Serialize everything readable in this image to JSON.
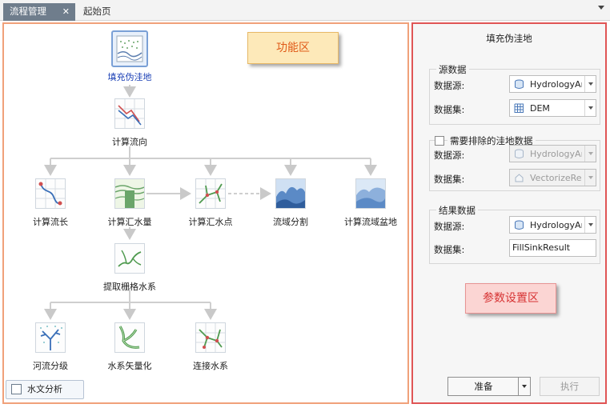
{
  "tabs": [
    {
      "label": "流程管理",
      "active": true,
      "close_icon": "close-icon"
    },
    {
      "label": "起始页",
      "active": false
    }
  ],
  "canvas": {
    "callout": "功能区",
    "bottom_tab": "水文分析",
    "nodes": {
      "fill_sink": {
        "label": "填充伪洼地",
        "icon": "fill-sink-icon"
      },
      "flow_dir": {
        "label": "计算流向",
        "icon": "flow-direction-icon"
      },
      "flow_len": {
        "label": "计算流长",
        "icon": "flow-length-icon"
      },
      "flow_acc": {
        "label": "计算汇水量",
        "icon": "flow-accumulation-icon"
      },
      "pour_pts": {
        "label": "计算汇水点",
        "icon": "pour-points-icon"
      },
      "watershed": {
        "label": "流域分割",
        "icon": "watershed-icon"
      },
      "basin": {
        "label": "计算流域盆地",
        "icon": "basin-icon"
      },
      "extract_net": {
        "label": "提取栅格水系",
        "icon": "stream-raster-icon"
      },
      "stream_order": {
        "label": "河流分级",
        "icon": "stream-order-icon"
      },
      "vectorize": {
        "label": "水系矢量化",
        "icon": "stream-vectorize-icon"
      },
      "link": {
        "label": "连接水系",
        "icon": "stream-link-icon"
      }
    }
  },
  "panel": {
    "title": "填充伪洼地",
    "source_group": {
      "legend": "源数据",
      "datasource_label": "数据源:",
      "datasource_value": "HydrologyAnalyst",
      "dataset_label": "数据集:",
      "dataset_value": "DEM"
    },
    "exclude_group": {
      "legend": "需要排除的洼地数据",
      "checked": false,
      "datasource_label": "数据源:",
      "datasource_value": "HydrologyAnalyst",
      "dataset_label": "数据集:",
      "dataset_value": "VectorizeResult"
    },
    "result_group": {
      "legend": "结果数据",
      "datasource_label": "数据源:",
      "datasource_value": "HydrologyAnalyst",
      "dataset_label": "数据集:",
      "dataset_value": "FillSinkResult"
    },
    "callout": "参数设置区",
    "prepare_button": "准备",
    "execute_button": "执行"
  }
}
